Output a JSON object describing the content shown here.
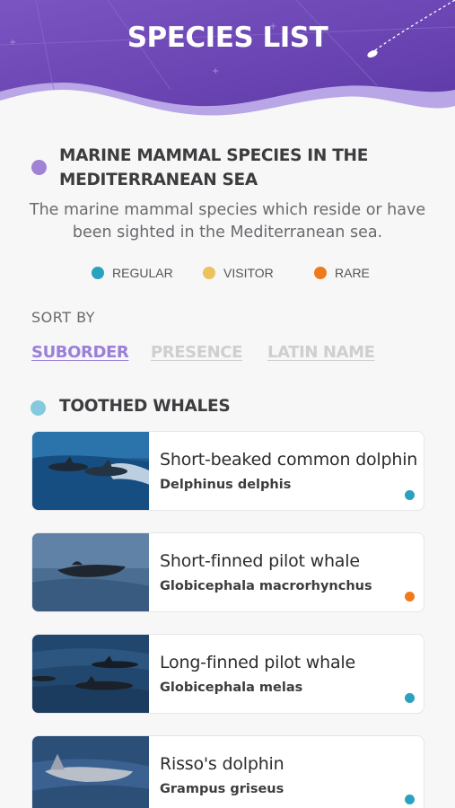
{
  "header": {
    "title": "SPECIES LIST"
  },
  "intro": {
    "title": "MARINE MAMMAL SPECIES IN THE MEDITERRANEAN SEA",
    "description": "The marine mammal species which reside or have been sighted in the Mediterranean sea."
  },
  "legend": [
    {
      "label": "REGULAR",
      "color": "#2aa1bf"
    },
    {
      "label": "VISITOR",
      "color": "#edc15e"
    },
    {
      "label": "RARE",
      "color": "#ee7a1c"
    }
  ],
  "sort": {
    "label": "SORT BY",
    "options": [
      "SUBORDER",
      "PRESENCE",
      "LATIN NAME"
    ],
    "selected": "SUBORDER"
  },
  "section": {
    "title": "TOOTHED WHALES"
  },
  "species": [
    {
      "name": "Short-beaked common dolphin",
      "latin": "Delphinus delphis",
      "presence": "REGULAR",
      "presence_color": "#2aa1bf"
    },
    {
      "name": "Short-finned pilot whale",
      "latin": "Globicephala macrorhynchus",
      "presence": "RARE",
      "presence_color": "#ee7a1c"
    },
    {
      "name": "Long-finned pilot whale",
      "latin": "Globicephala melas",
      "presence": "REGULAR",
      "presence_color": "#2aa1bf"
    },
    {
      "name": "Risso's dolphin",
      "latin": "Grampus griseus",
      "presence": "REGULAR",
      "presence_color": "#2aa1bf"
    }
  ],
  "colors": {
    "header": "#6b48b3",
    "accent": "#9b7fd8"
  }
}
